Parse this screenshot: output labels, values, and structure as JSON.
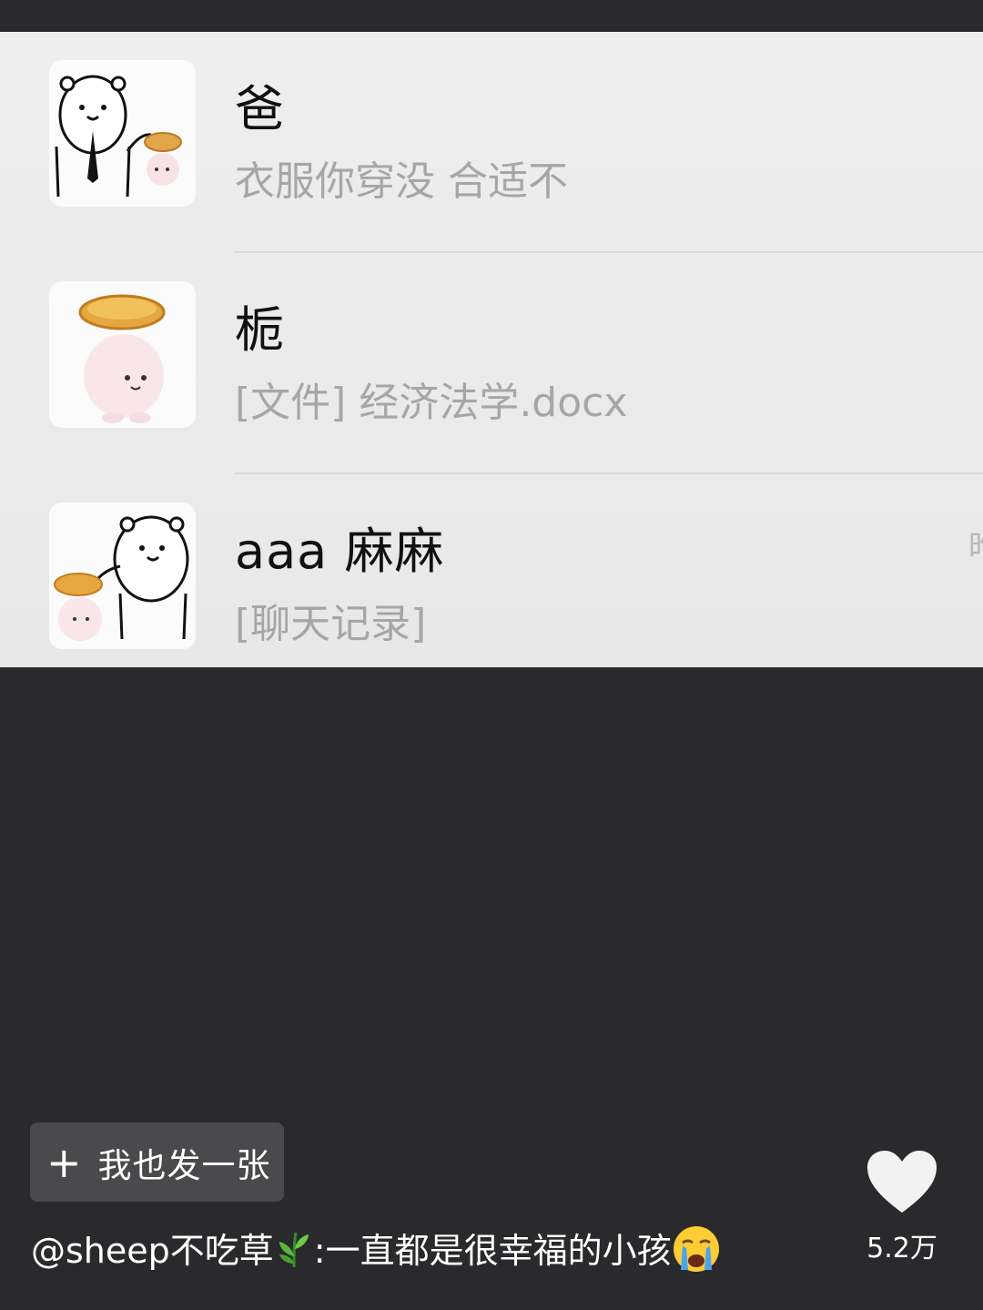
{
  "screenshot": {
    "chats": [
      {
        "name": "爸",
        "preview": "衣服你穿没 合适不"
      },
      {
        "name": "栀",
        "preview": "[文件] 经济法学.docx"
      },
      {
        "name": "aaa 麻麻",
        "preview": "[聊天记录]",
        "time_peek": "昨"
      }
    ]
  },
  "post_button": {
    "plus": "+",
    "label": "我也发一张"
  },
  "caption": {
    "username": "@sheep不吃草",
    "leaf_icon": "herb-leaf-icon",
    "separator": ":",
    "text": "一直都是很幸福的小孩",
    "emoji_icon": "crying-face-icon"
  },
  "like": {
    "icon": "heart-icon",
    "count": "5.2万"
  },
  "colors": {
    "background": "#2a2a2c",
    "chat_bg": "#eeeeee",
    "preview_text": "#a6a6a6",
    "button_bg": "#4a4a4c"
  }
}
